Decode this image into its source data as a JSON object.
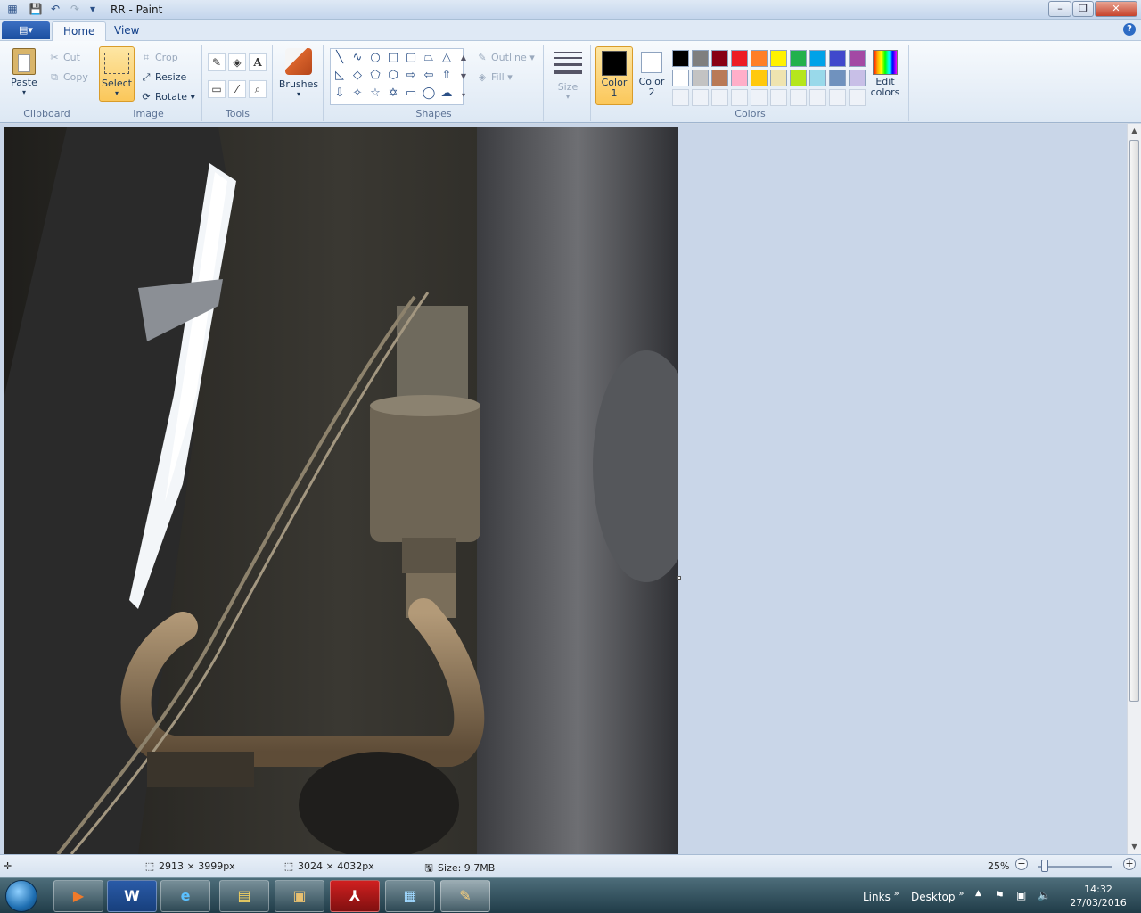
{
  "window": {
    "title": "RR - Paint",
    "controls": {
      "minimize": "–",
      "maximize": "❐",
      "close": "✕"
    }
  },
  "qat": [
    "save-icon",
    "undo-icon",
    "redo-icon",
    "customize-icon"
  ],
  "tabs": {
    "file_glyph": "▤▾",
    "home": "Home",
    "view": "View",
    "help": "?"
  },
  "ribbon": {
    "clipboard": {
      "label": "Clipboard",
      "paste": "Paste",
      "cut": "Cut",
      "copy": "Copy"
    },
    "image": {
      "label": "Image",
      "select": "Select",
      "crop": "Crop",
      "resize": "Resize",
      "rotate": "Rotate"
    },
    "tools": {
      "label": "Tools"
    },
    "brushes": {
      "label": "Brushes"
    },
    "shapes": {
      "label": "Shapes",
      "outline": "Outline",
      "fill": "Fill"
    },
    "size": {
      "label": "Size"
    },
    "colors": {
      "label": "Colors",
      "color1": "Color\n1",
      "color2": "Color\n2",
      "color1_value": "#000000",
      "color2_value": "#ffffff",
      "edit": "Edit\ncolors",
      "palette_row1": [
        "#000000",
        "#7f7f7f",
        "#880015",
        "#ed1c24",
        "#ff7f27",
        "#fff200",
        "#22b14c",
        "#00a2e8",
        "#3f48cc",
        "#a349a4"
      ],
      "palette_row2": [
        "#ffffff",
        "#c3c3c3",
        "#b97a57",
        "#ffaec9",
        "#ffc90e",
        "#efe4b0",
        "#b5e61d",
        "#99d9ea",
        "#7092be",
        "#c8bfe7"
      ]
    }
  },
  "status": {
    "selection_size": "2913 × 3999px",
    "image_size": "3024 × 4032px",
    "file_size": "Size: 9.7MB",
    "zoom": "25%",
    "zoom_fraction": 0.1
  },
  "taskbar": {
    "apps": [
      "media-player",
      "word",
      "internet-explorer",
      "file-explorer",
      "photo-viewer",
      "acrobat",
      "pictures",
      "paint"
    ],
    "links": "Links",
    "desktop": "Desktop",
    "time": "14:32",
    "date": "27/03/2016"
  }
}
